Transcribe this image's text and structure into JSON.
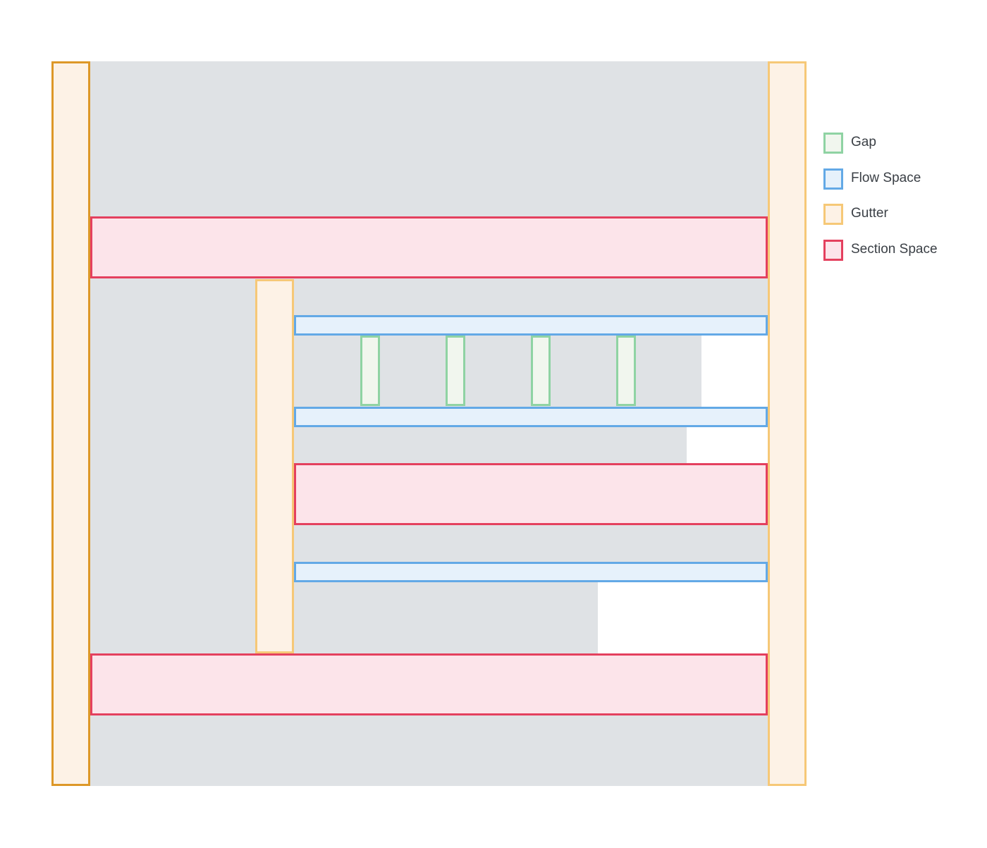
{
  "legend": {
    "items": [
      {
        "label": "Gap",
        "kind": "gap",
        "border_color": "#8fd3a3",
        "fill_color": "#f1f6ee"
      },
      {
        "label": "Flow Space",
        "kind": "flow",
        "border_color": "#63a9e6",
        "fill_color": "#e6f1fb"
      },
      {
        "label": "Gutter",
        "kind": "gutter",
        "border_color": "#f6c877",
        "fill_color": "#fdf2e6"
      },
      {
        "label": "Section Space",
        "kind": "section",
        "border_color": "#e4405e",
        "fill_color": "#fce4ea"
      }
    ]
  },
  "colors": {
    "content_background": "#dfe2e5",
    "page_background": "#ffffff"
  }
}
